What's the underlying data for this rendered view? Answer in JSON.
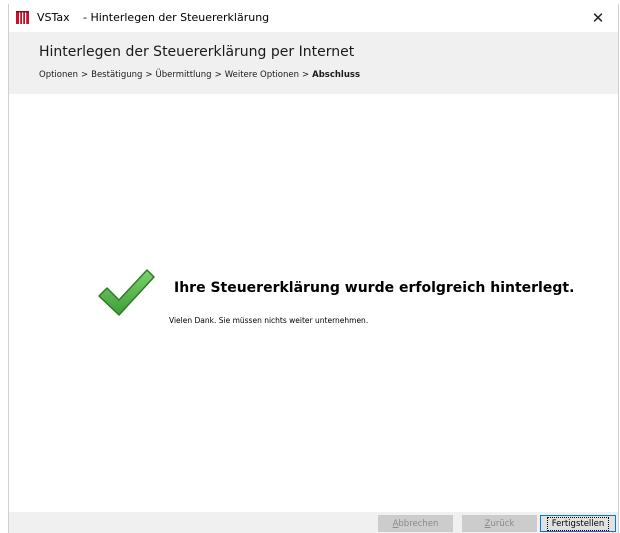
{
  "window": {
    "app_name": "VSTax",
    "title": "- Hinterlegen der Steuererklärung",
    "close_glyph": "✕",
    "app_icon": "vstax-logo-icon"
  },
  "header": {
    "title": "Hinterlegen der Steuererklärung per Internet",
    "breadcrumb": {
      "separator": ">",
      "steps": [
        "Optionen",
        "Bestätigung",
        "Übermittlung",
        "Weitere Optionen"
      ],
      "current": "Abschluss"
    }
  },
  "content": {
    "icon": "checkmark-icon",
    "icon_color": "#5cb85c",
    "title": "Ihre Steuererklärung wurde erfolgreich hinterlegt.",
    "subtitle": "Vielen Dank. Sie müssen nichts weiter unternehmen."
  },
  "footer": {
    "cancel": {
      "accel": "A",
      "rest": "bbrechen",
      "enabled": false
    },
    "back": {
      "accel": "Z",
      "rest": "urück",
      "enabled": false
    },
    "finish": {
      "label": "Fertigstellen",
      "enabled": true
    }
  }
}
